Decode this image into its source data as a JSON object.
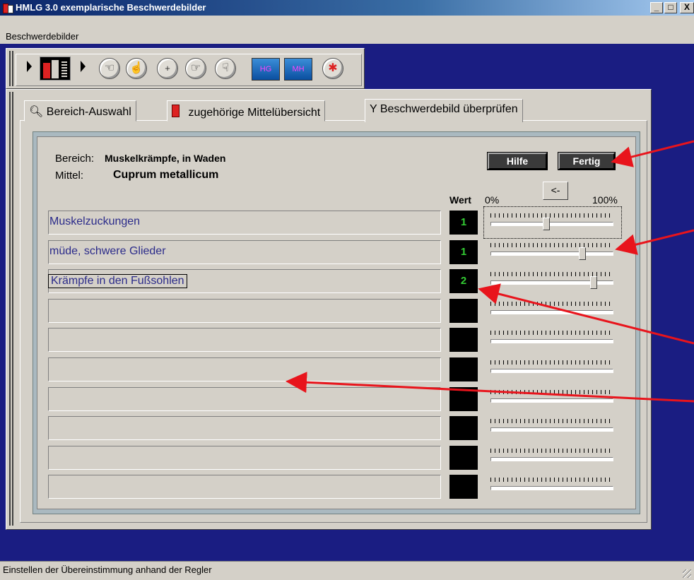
{
  "window": {
    "title": "HMLG 3.0 exemplarische Beschwerdebilder",
    "min": "_",
    "max": "□",
    "close": "X"
  },
  "menu": {
    "item": "Beschwerdebilder"
  },
  "toolbar": {
    "hg_label": "HG",
    "mh_label": "MH"
  },
  "tabs": [
    {
      "label": "Bereich-Auswahl",
      "icon": "magnifier-icon"
    },
    {
      "label": "zugehörige Mittelübersicht",
      "icon": "bottle-icon"
    },
    {
      "label": "Beschwerdebild überprüfen",
      "icon": "dowsing-rod-icon"
    }
  ],
  "form": {
    "bereich_label": "Bereich:",
    "bereich_value": "Muskelkrämpfe, in Waden",
    "mittel_label": "Mittel:",
    "mittel_value": "Cuprum metallicum",
    "hilfe_button": "Hilfe",
    "fertig_button": "Fertig",
    "back_button": "<-",
    "wert_header": "Wert",
    "pct_min": "0%",
    "pct_max": "100%"
  },
  "rows": [
    {
      "text": "Muskelzuckungen",
      "wert": "1",
      "slider_level": 0.45
    },
    {
      "text": "müde, schwere Glieder",
      "wert": "1",
      "slider_level": 0.76
    },
    {
      "text": "Krämpfe in den Fußsohlen",
      "wert": "2",
      "slider_level": 0.86
    },
    {
      "text": "",
      "wert": ""
    },
    {
      "text": "",
      "wert": ""
    },
    {
      "text": "",
      "wert": ""
    },
    {
      "text": "",
      "wert": ""
    },
    {
      "text": "",
      "wert": ""
    },
    {
      "text": "",
      "wert": ""
    },
    {
      "text": "",
      "wert": ""
    }
  ],
  "status": {
    "text": "Einstellen der Übereinstimmung anhand der Regler"
  },
  "colors": {
    "workspace": "#1a1d82",
    "annotation_arrow": "#e8141c",
    "wert_digit": "#33cc33"
  }
}
